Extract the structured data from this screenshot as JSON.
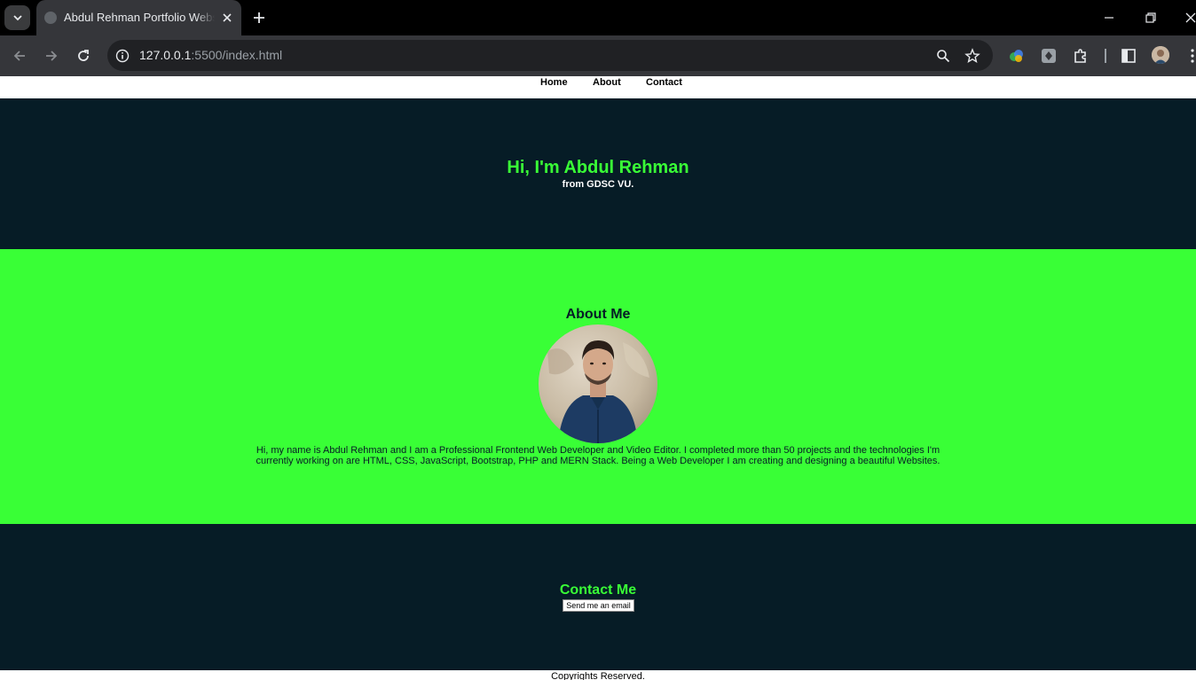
{
  "browser": {
    "tab": {
      "title": "Abdul Rehman Portfolio Website"
    },
    "omnibox": {
      "host": "127.0.0.1",
      "path": ":5500/index.html"
    }
  },
  "nav": {
    "items": [
      {
        "label": "Home"
      },
      {
        "label": "About"
      },
      {
        "label": "Contact"
      }
    ]
  },
  "hero": {
    "title": "Hi, I'm Abdul Rehman",
    "subtitle": "from GDSC VU."
  },
  "about": {
    "heading": "About Me",
    "text": "Hi, my name is Abdul Rehman and I am a Professional Frontend Web Developer and Video Editor. I completed more than 50 projects and the technologies I'm currently working on are HTML, CSS, JavaScript, Bootstrap, PHP and MERN Stack. Being a Web Developer I am creating and designing a beautiful Websites."
  },
  "contact": {
    "heading": "Contact Me",
    "button_label": "Send me an email"
  },
  "footer": {
    "text": "Copyrights Reserved."
  },
  "colors": {
    "accent_green": "#39ff36",
    "dark_navy": "#061c26",
    "browser_dark": "#35363a"
  }
}
